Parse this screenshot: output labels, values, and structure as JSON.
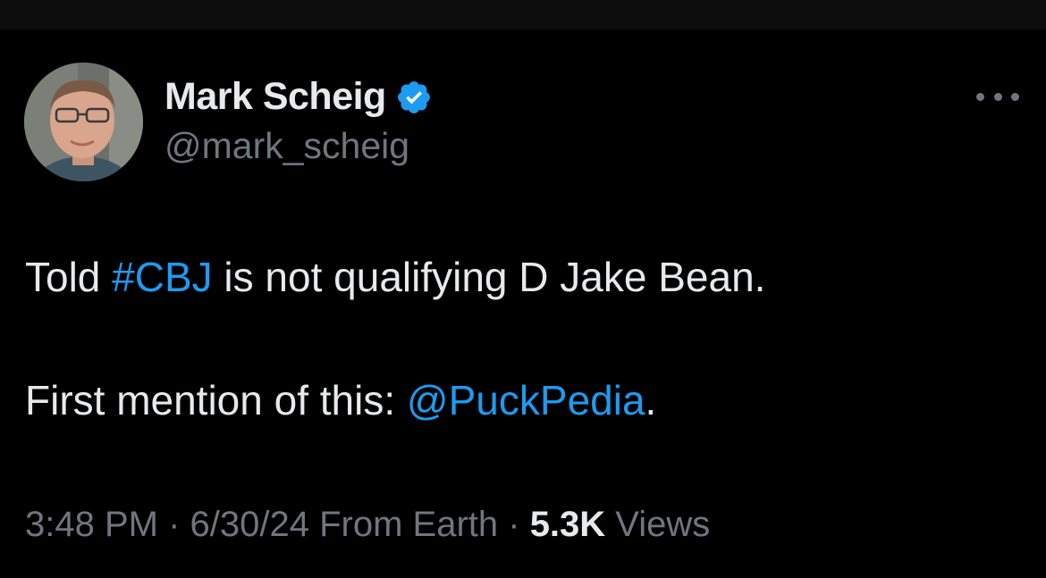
{
  "colors": {
    "background": "#000000",
    "text_primary": "#e7e9ea",
    "text_secondary": "#71767b",
    "link": "#1d9bf0",
    "verified_badge": "#1d9bf0"
  },
  "author": {
    "name": "Mark Scheig",
    "handle": "@mark_scheig",
    "verified_icon": "verified-badge-icon"
  },
  "tweet": {
    "line1": {
      "before": "Told ",
      "hashtag": "#CBJ",
      "after": " is not qualifying D Jake Bean."
    },
    "line2": {
      "before": "First mention of this: ",
      "mention": "@PuckPedia",
      "after": "."
    }
  },
  "meta": {
    "time": "3:48 PM",
    "sep1": " · ",
    "date": "6/30/24",
    "source": " From Earth",
    "sep2": " · ",
    "views_count": "5.3K",
    "views_label": " Views"
  },
  "menu": {
    "more_icon": "more-horizontal-icon"
  }
}
